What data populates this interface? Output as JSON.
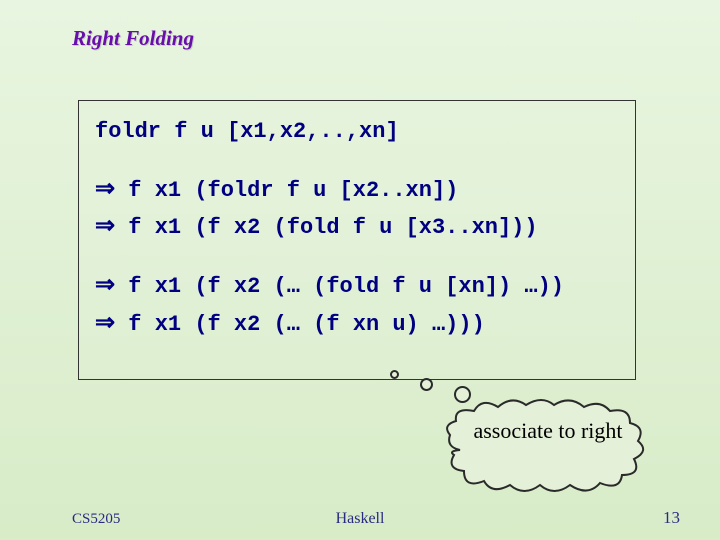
{
  "title": "Right Folding",
  "code": {
    "l1": "foldr f u [x1,x2,..,xn]",
    "l2a": " f x1 (foldr f u [x2..xn])",
    "l2b": " f x1 (f x2 (fold f u [x3..xn]))",
    "l3a": " f x1 (f x2 (… (fold f u [xn]) …))",
    "l3b": " f x1 (f x2 (… (f xn u) …)))"
  },
  "arrow": "⇒",
  "callout": "associate to right",
  "footer": {
    "left": "CS5205",
    "center": "Haskell",
    "right": "13"
  }
}
